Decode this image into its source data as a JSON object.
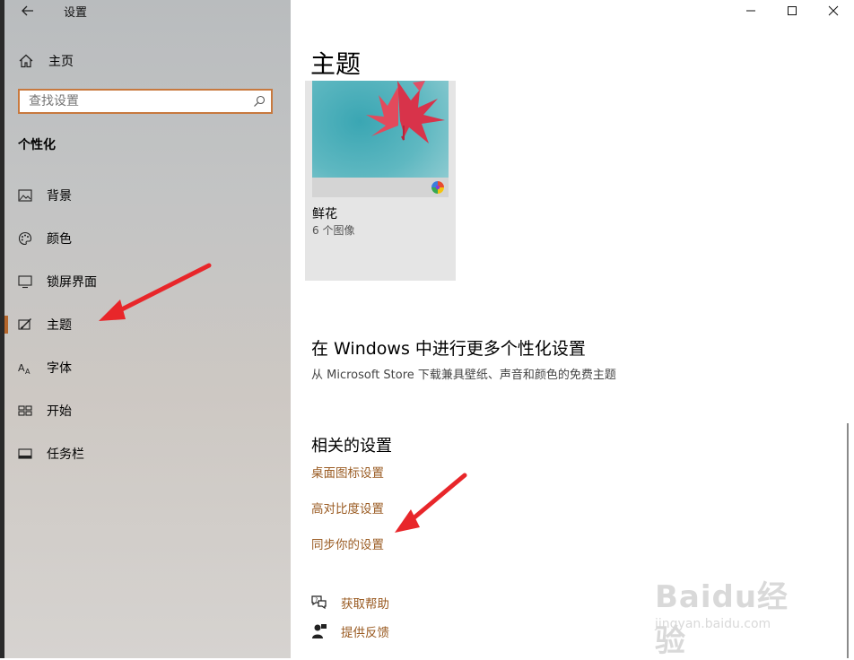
{
  "app": {
    "title": "设置"
  },
  "nav": {
    "home_label": "主页",
    "search_placeholder": "查找设置",
    "section_heading": "个性化",
    "items": [
      {
        "label": "背景",
        "icon": "picture-icon"
      },
      {
        "label": "颜色",
        "icon": "palette-icon"
      },
      {
        "label": "锁屏界面",
        "icon": "monitor-icon"
      },
      {
        "label": "主题",
        "icon": "theme-brush-icon",
        "active": true
      },
      {
        "label": "字体",
        "icon": "font-icon"
      },
      {
        "label": "开始",
        "icon": "start-grid-icon"
      },
      {
        "label": "任务栏",
        "icon": "taskbar-icon"
      }
    ]
  },
  "main": {
    "title": "主题",
    "theme_card": {
      "name": "鲜花",
      "count": "6 个图像"
    },
    "more": {
      "heading": "在 Windows 中进行更多个性化设置",
      "description": "从 Microsoft Store 下载兼具壁纸、声音和颜色的免费主题"
    },
    "related": {
      "heading": "相关的设置",
      "links": [
        "桌面图标设置",
        "高对比度设置",
        "同步你的设置"
      ]
    },
    "help": {
      "get_help": "获取帮助",
      "feedback": "提供反馈"
    }
  },
  "watermark": {
    "main": "Baidu经验",
    "sub": "jingyan.baidu.com"
  },
  "colors": {
    "accent": "#c8793e",
    "link": "#9a5b22",
    "arrow": "#e8262a",
    "indicator": "#b5662b"
  }
}
